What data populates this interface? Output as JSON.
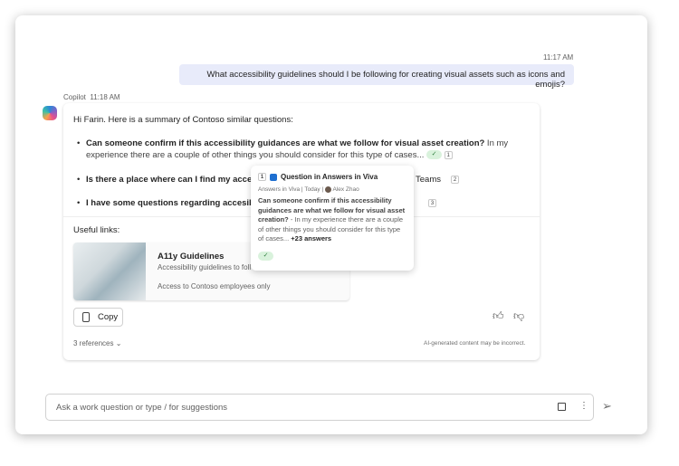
{
  "user_message": {
    "time": "11:17 AM",
    "text": "What accessibility guidelines should I be following for creating visual assets such as icons and emojis?"
  },
  "copilot": {
    "name": "Copilot",
    "time": "11:18 AM",
    "intro": "Hi Farin. Here is a summary of Contoso similar questions:",
    "bullets": [
      {
        "bold": "Can someone confirm if this accessibility guidances are what we follow for visual asset creation?",
        "rest": " In my experience there are a couple of other things you should consider for this type of cases...",
        "ref": "1",
        "verified": true
      },
      {
        "bold": "Is there a place where can I find my accessi",
        "rest": "Teams",
        "ref": "2"
      },
      {
        "bold": "I have some questions regarding accesibilit",
        "rest": "",
        "ref": "3"
      }
    ],
    "useful_links_label": "Useful links:",
    "link_card": {
      "title": "A11y Guidelines",
      "subtitle": "Accessibility guidelines to foll",
      "access": "Access to Contoso employees only"
    },
    "copy_label": "Copy",
    "references_label": "3 references",
    "disclaimer": "AI-generated content may be incorrect."
  },
  "popup": {
    "ref": "1",
    "title": "Question in Answers in Viva",
    "source": "Answers in Viva",
    "date": "Today",
    "author": "Alex Zhao",
    "question": "Can someone confirm if this accessibility guidances are what we follow for visual asset creation?",
    "answer": " - In my experience there are a couple of other things you should consider for this type of cases...",
    "more": " +23 answers"
  },
  "composer": {
    "placeholder": "Ask a work question or type / for suggestions"
  }
}
